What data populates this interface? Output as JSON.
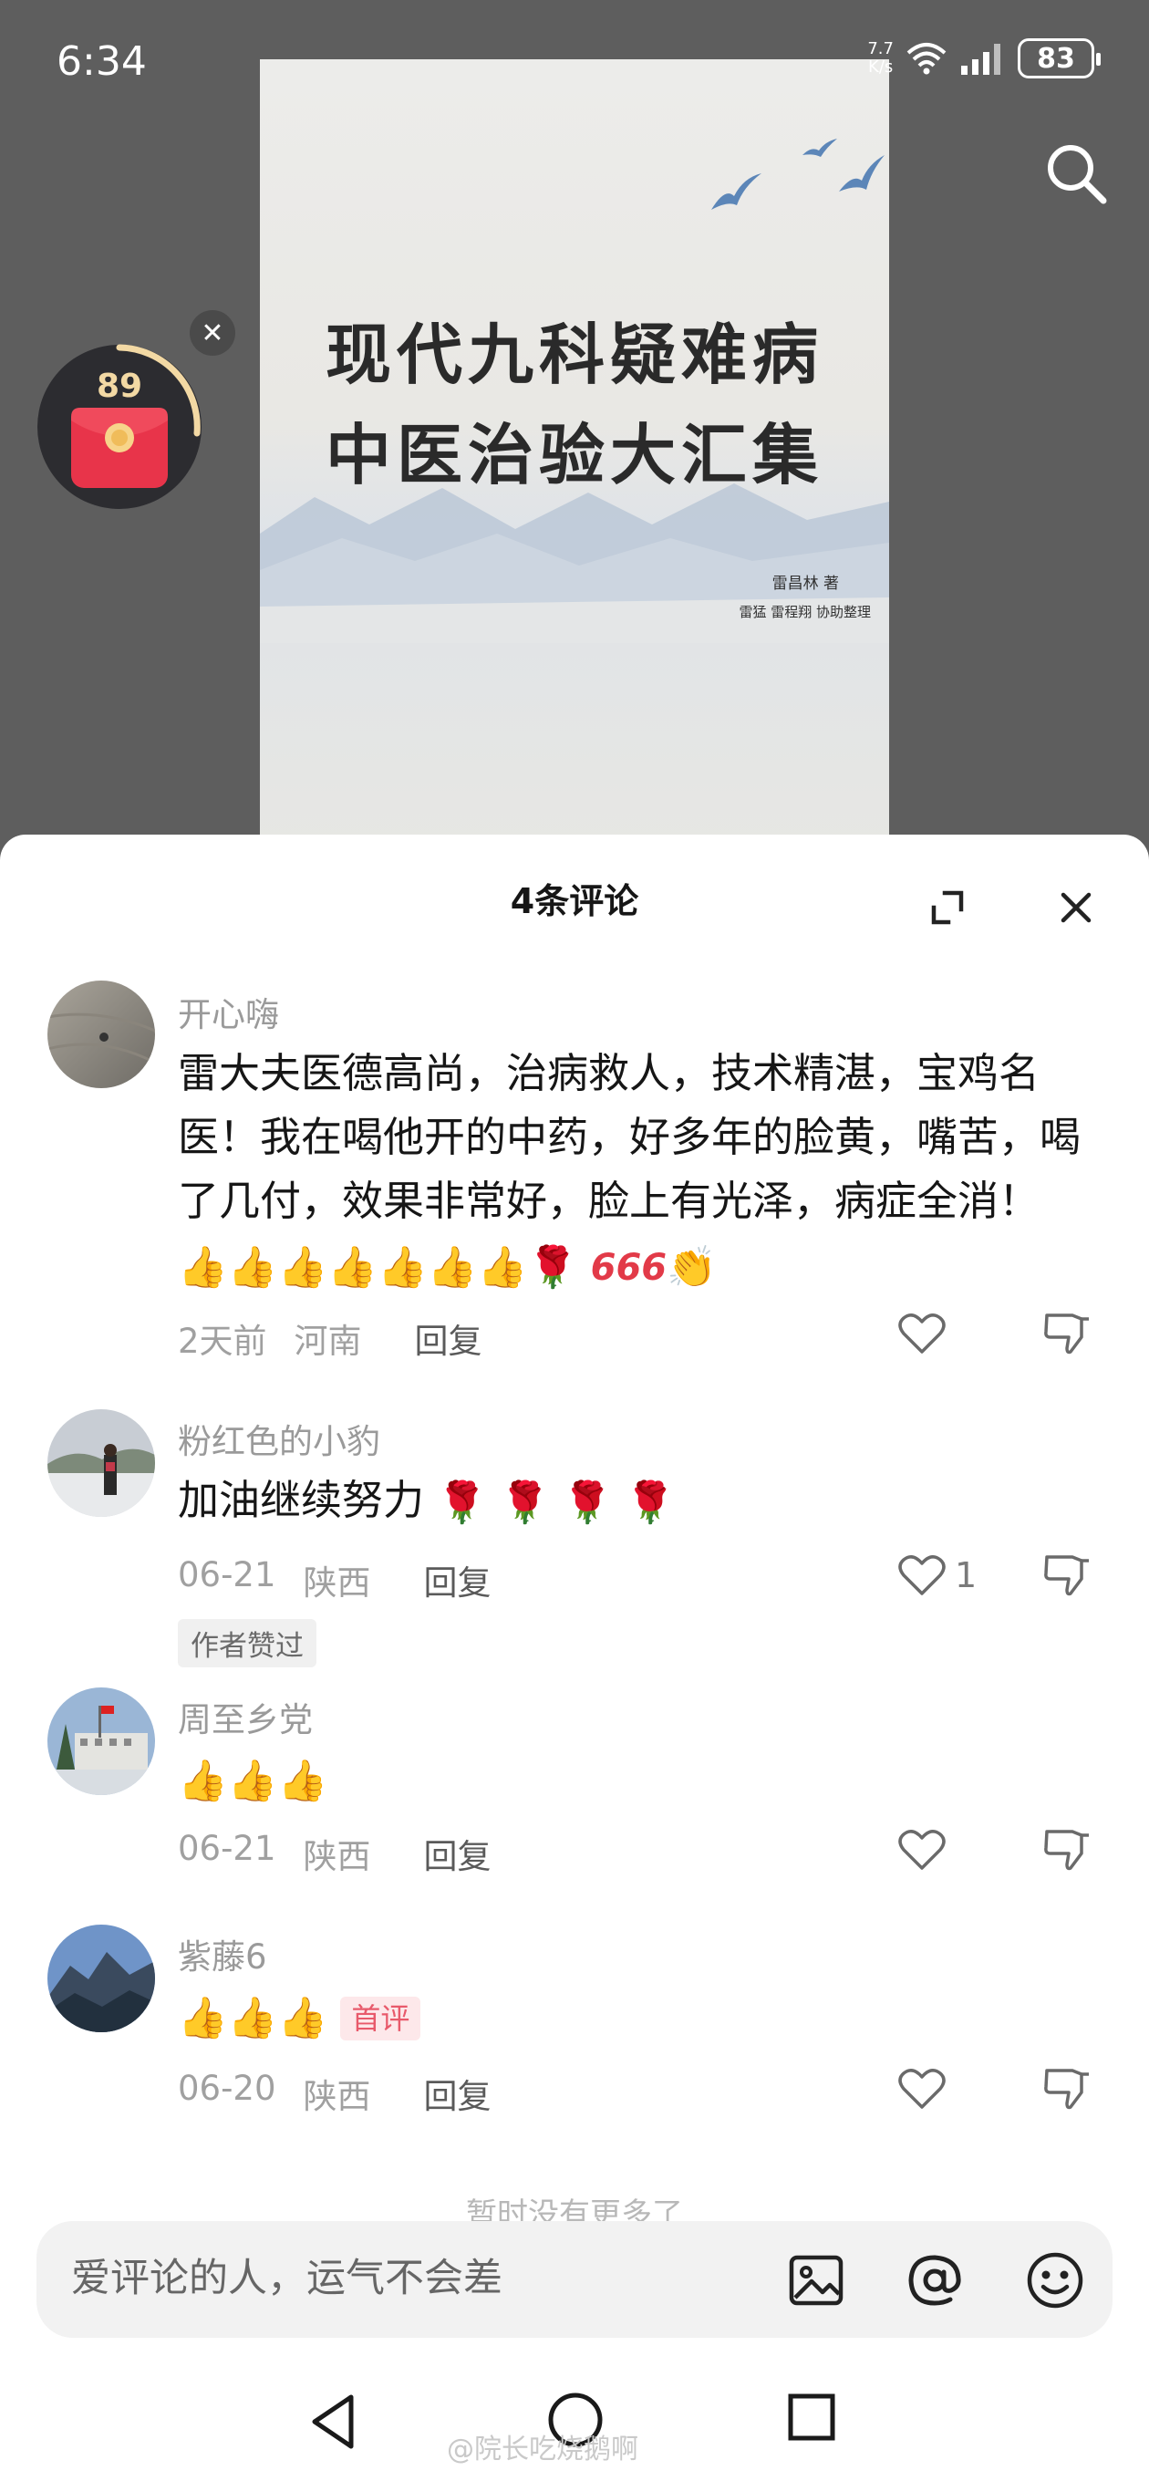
{
  "status": {
    "time": "6:34",
    "net_speed_value": "7.7",
    "net_speed_unit": "K/s",
    "battery": "83"
  },
  "book": {
    "title_line1": "现代九科疑难病",
    "title_line2": "中医治验大汇集",
    "author": "雷昌林  著",
    "editors": "雷猛  雷程翔  协助整理"
  },
  "widget": {
    "count": "89",
    "close_symbol": "✕"
  },
  "sheet": {
    "title": "4条评论"
  },
  "comments": [
    {
      "user": "开心嗨",
      "text": "雷大夫医德高尚，治病救人，技术精湛，宝鸡名医！我在喝他开的中药，好多年的脸黄，嘴苦，喝了几付，效果非常好，脸上有光泽，病症全消！",
      "emoji_six": "666",
      "time": "2天前",
      "location": "河南",
      "reply": "回复",
      "likes": ""
    },
    {
      "user": "粉红色的小豹",
      "text": "加油继续努力",
      "time": "06-21",
      "location": "陕西",
      "reply": "回复",
      "likes": "1",
      "author_liked": "作者赞过"
    },
    {
      "user": "周至乡党",
      "text": "",
      "time": "06-21",
      "location": "陕西",
      "reply": "回复",
      "likes": ""
    },
    {
      "user": "紫藤6",
      "text": "",
      "badge": "首评",
      "time": "06-20",
      "location": "陕西",
      "reply": "回复",
      "likes": ""
    }
  ],
  "no_more": "暂时没有更多了",
  "input": {
    "placeholder": "爱评论的人，运气不会差"
  },
  "watermark": "@院长吃烧鹅啊",
  "icons": {
    "search": "search-icon",
    "expand": "expand-icon",
    "close": "close-icon",
    "like": "heart-icon",
    "dislike": "thumbs-down-icon",
    "image": "image-icon",
    "at": "at-icon",
    "emoji": "emoji-icon",
    "back": "back-icon",
    "home": "home-icon",
    "recent": "recent-apps-icon"
  },
  "colors": {
    "accent_red": "#e8344a",
    "badge_pink": "#e85a6b",
    "text_primary": "#161616",
    "text_secondary": "#9a9a9a"
  }
}
